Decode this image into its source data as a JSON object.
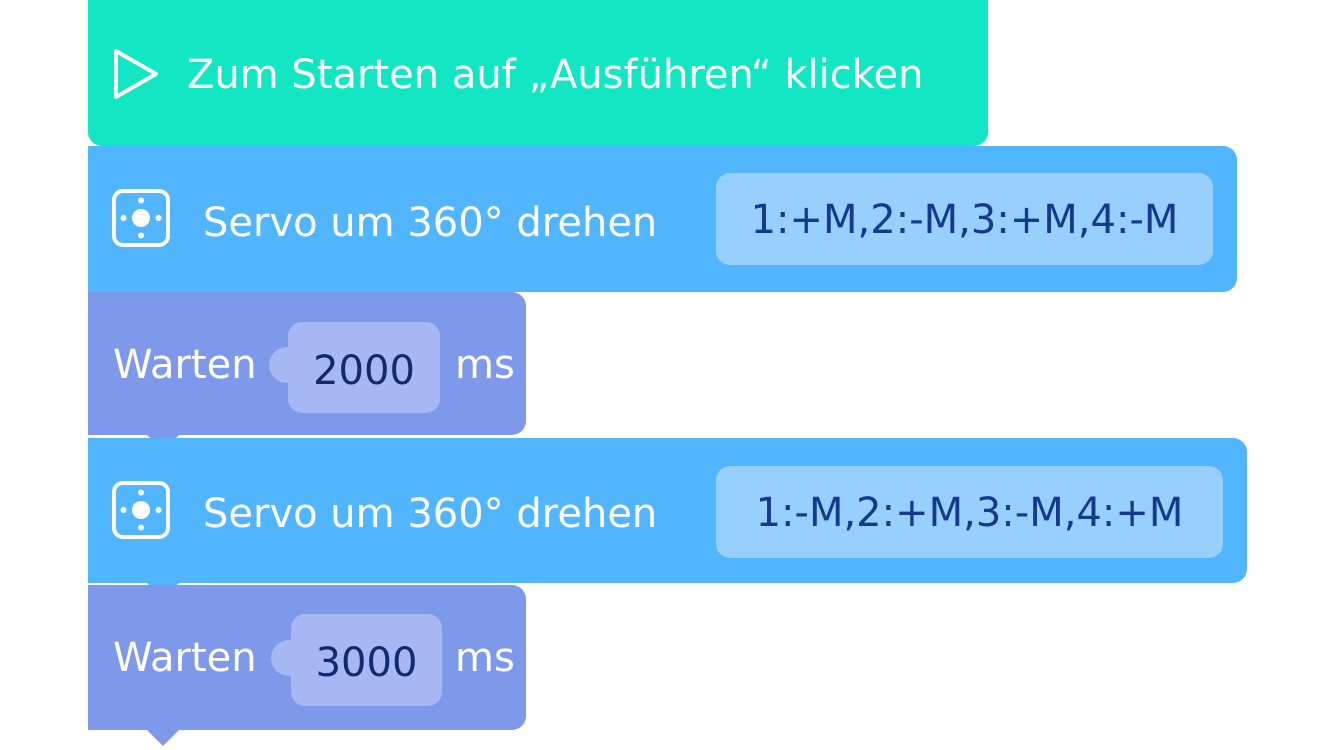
{
  "colors": {
    "start_block": "#12e6c2",
    "servo_block": "#51b5ff",
    "servo_param": "#97cffe",
    "wait_block": "#7e99ea",
    "wait_param": "#a7b7f4",
    "param_text": "#143a8e"
  },
  "program": {
    "start": {
      "icon": "play-icon",
      "label": "Zum Starten auf „Ausführen“ klicken"
    },
    "blocks": [
      {
        "type": "servo",
        "icon": "servo-icon",
        "label": "Servo um 360° drehen",
        "value": "1:+M,2:-M,3:+M,4:-M"
      },
      {
        "type": "wait",
        "label": "Warten",
        "value": "2000",
        "unit": "ms"
      },
      {
        "type": "servo",
        "icon": "servo-icon",
        "label": "Servo um 360° drehen",
        "value": "1:-M,2:+M,3:-M,4:+M"
      },
      {
        "type": "wait",
        "label": "Warten",
        "value": "3000",
        "unit": "ms"
      }
    ]
  }
}
